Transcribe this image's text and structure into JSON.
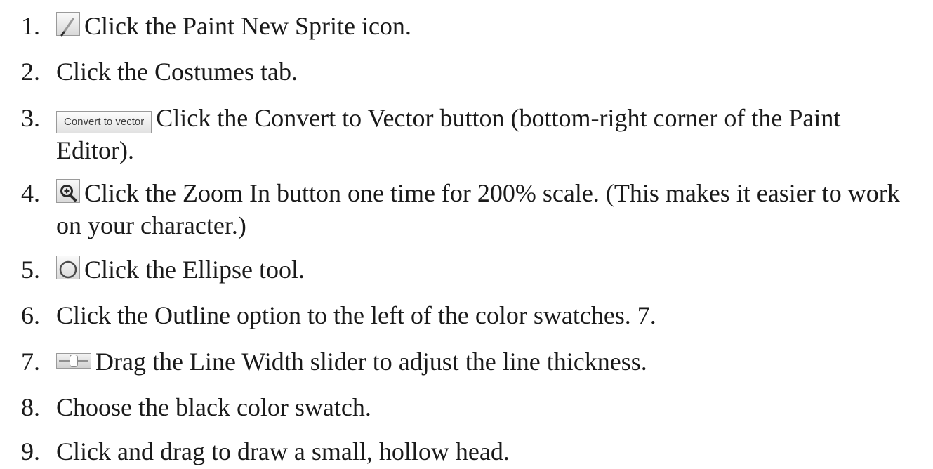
{
  "steps": [
    {
      "number": "1.",
      "icon": "brush-icon",
      "text": "Click the Paint New Sprite icon."
    },
    {
      "number": "2.",
      "icon": "",
      "text": "Click the Costumes tab."
    },
    {
      "number": "3.",
      "icon": "convert-to-vector-button",
      "icon_label": "Convert to vector",
      "text": "Click the Convert to Vector button (bottom-right corner of the Paint Editor)."
    },
    {
      "number": "4.",
      "icon": "zoom-in-icon",
      "text": "Click the Zoom In button one time for 200% scale. (This makes it easier to work on your character.)"
    },
    {
      "number": "5.",
      "icon": "ellipse-icon",
      "text": "Click the Ellipse tool."
    },
    {
      "number": "6.",
      "icon": "",
      "text": "Click the Outline option to the left of the color swatches. 7."
    },
    {
      "number": "7.",
      "icon": "line-width-slider-icon",
      "text": "Drag the Line Width slider to adjust the line thickness."
    },
    {
      "number": "8.",
      "icon": "",
      "text": "Choose the black color swatch."
    },
    {
      "number": "9.",
      "icon": "",
      "text": "Click and drag to draw a small, hollow head."
    }
  ]
}
